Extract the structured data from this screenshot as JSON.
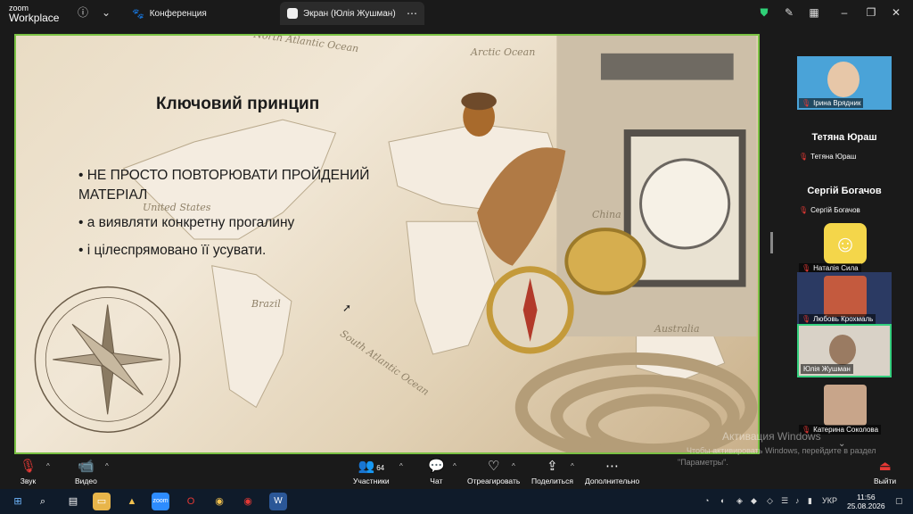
{
  "app": {
    "logo_line1": "zoom",
    "logo_line2": "Workplace"
  },
  "tabs": [
    {
      "label": "Конференция"
    },
    {
      "label": "Экран (Юлія Жушман)"
    }
  ],
  "slide": {
    "title": "Ключовий принцип",
    "bullets": [
      "• НЕ ПРОСТО ПОВТОРЮВАТИ ПРОЙДЕНИЙ МАТЕРІАЛ",
      "• а виявляти конкретну прогалину",
      "• і цілеспрямовано її усувати."
    ],
    "map_labels": {
      "north_atlantic": "North Atlantic Ocean",
      "arctic": "Arctic Ocean",
      "united_states": "United States",
      "brazil": "Brazil",
      "south_atlantic": "South Atlantic Ocean",
      "china": "China",
      "australia": "Australia"
    }
  },
  "participants": {
    "tiles": [
      {
        "name": "Ірина Врядник"
      },
      {
        "big": "Тетяна Юраш",
        "name": "Тетяна Юраш"
      },
      {
        "big": "Сергій Богачов",
        "name": "Сергій Богачов"
      },
      {
        "name": "Наталія Сила"
      },
      {
        "name": "Любовь Крохмаль"
      },
      {
        "name": "Юлія Жушман"
      },
      {
        "name": "Катерина Соколова"
      }
    ]
  },
  "toolbar": {
    "sound": "Звук",
    "video": "Видео",
    "participants_count": "64",
    "participants": "Участники",
    "chat": "Чат",
    "react": "Отреагировать",
    "share": "Поделиться",
    "more": "Дополнительно",
    "leave": "Выйти"
  },
  "watermark": {
    "line1": "Активация Windows",
    "line2": "Чтобы активировать Windows, перейдите в раздел",
    "line3": "\"Параметры\"."
  },
  "taskbar": {
    "lang": "УКР",
    "time": "11:56",
    "date": "25.08.2026"
  },
  "colors": {
    "active_border": "#35d07f",
    "share_border": "#7ac143",
    "muted": "#e53935"
  }
}
